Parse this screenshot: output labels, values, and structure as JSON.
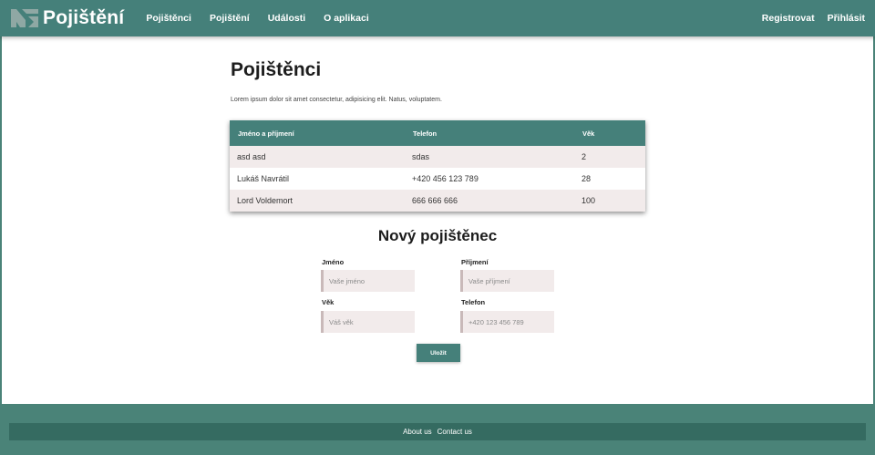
{
  "navbar": {
    "brand": "Pojištění",
    "links": [
      "Pojištěnci",
      "Pojištění",
      "Události",
      "O aplikaci"
    ],
    "register": "Registrovat",
    "login": "Přihlásit"
  },
  "page": {
    "title": "Pojištěnci",
    "lead": "Lorem ipsum dolor sit amet consectetur, adipisicing elit. Natus, voluptatem."
  },
  "table": {
    "headers": [
      "Jméno a příjmení",
      "Telefon",
      "Věk"
    ],
    "rows": [
      [
        "asd asd",
        "sdas",
        "2"
      ],
      [
        "Lukáš Navrátil",
        "+420 456 123 789",
        "28"
      ],
      [
        "Lord Voldemort",
        "666 666 666",
        "100"
      ]
    ]
  },
  "form": {
    "title": "Nový pojištěnec",
    "first_name_label": "Jméno",
    "first_name_placeholder": "Vaše jméno",
    "last_name_label": "Příjmení",
    "last_name_placeholder": "Vaše příjmení",
    "age_label": "Věk",
    "age_placeholder": "Váš věk",
    "phone_label": "Telefon",
    "phone_placeholder": "+420 123 456 789",
    "save_label": "Uložit"
  },
  "footer": {
    "about": "About us",
    "contact": "Contact us"
  },
  "colors": {
    "accent": "#45807a",
    "footer_bar": "#356b61",
    "row_shade": "#f2ebeb"
  },
  "icons": {
    "brand_logo": "brand-logo-icon"
  }
}
